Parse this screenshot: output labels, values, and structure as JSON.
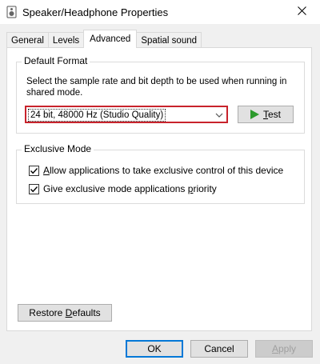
{
  "window": {
    "title": "Speaker/Headphone Properties",
    "icon": "speaker-icon",
    "close_icon": "close-icon"
  },
  "tabs": [
    {
      "label": "General",
      "active": false
    },
    {
      "label": "Levels",
      "active": false
    },
    {
      "label": "Advanced",
      "active": true
    },
    {
      "label": "Spatial sound",
      "active": false
    }
  ],
  "default_format": {
    "label": "Default Format",
    "description": "Select the sample rate and bit depth to be used when running in shared mode.",
    "selected_format": "24 bit, 48000 Hz (Studio Quality)",
    "test_button": {
      "label_prefix": "",
      "label_underlined": "T",
      "label_suffix": "est",
      "icon": "play-icon"
    }
  },
  "exclusive_mode": {
    "label": "Exclusive Mode",
    "options": [
      {
        "label_prefix": "",
        "label_underlined": "A",
        "label_suffix": "llow applications to take exclusive control of this device",
        "checked": true
      },
      {
        "label_prefix": "Give exclusive mode applications ",
        "label_underlined": "p",
        "label_suffix": "riority",
        "checked": true
      }
    ]
  },
  "restore_defaults": {
    "label_prefix": "Restore ",
    "label_underlined": "D",
    "label_suffix": "efaults"
  },
  "footer": {
    "ok_label": "OK",
    "cancel_label": "Cancel",
    "apply_label_prefix": "",
    "apply_label_underlined": "A",
    "apply_label_suffix": "pply",
    "apply_enabled": false
  },
  "colors": {
    "highlight_border": "#c8232c",
    "play_icon": "#2c9a2c",
    "default_button_border": "#0078d7"
  }
}
